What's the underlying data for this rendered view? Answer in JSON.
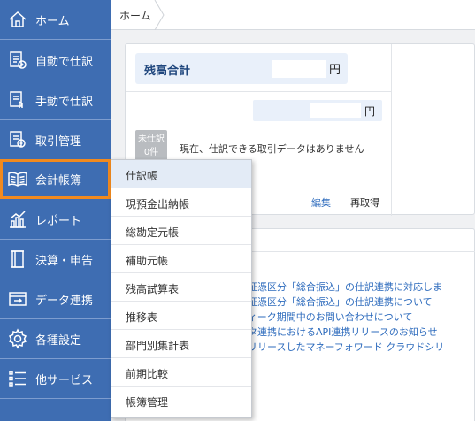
{
  "sidebar": {
    "items": [
      {
        "label": "ホーム",
        "icon": "home-icon"
      },
      {
        "label": "自動で仕訳",
        "icon": "auto-journal-icon"
      },
      {
        "label": "手動で仕訳",
        "icon": "manual-journal-icon"
      },
      {
        "label": "取引管理",
        "icon": "transaction-icon"
      },
      {
        "label": "会計帳簿",
        "icon": "book-icon"
      },
      {
        "label": "レポート",
        "icon": "chart-icon"
      },
      {
        "label": "決算・申告",
        "icon": "document-icon"
      },
      {
        "label": "データ連携",
        "icon": "sync-icon"
      },
      {
        "label": "各種設定",
        "icon": "gear-icon"
      },
      {
        "label": "他サービス",
        "icon": "list-icon"
      }
    ],
    "active_index": 4,
    "active_color": "#f28a1e",
    "bg_color": "#3e6db2"
  },
  "breadcrumb": {
    "home": "ホーム"
  },
  "summary": {
    "total_label": "残高合計",
    "unit": "円",
    "sub_unit": "円",
    "badge_line1": "未仕訳",
    "badge_line2": "0件",
    "notice": "現在、仕訳できる取引データはありません",
    "edit": "編集",
    "refresh": "再取得"
  },
  "news": [
    "の証憑区分「総合振込」の仕訳連携に対応しま",
    "の証憑区分「総合振込」の仕訳連携について",
    "フィーク期間中のお問い合わせについて",
    "ータ連携におけるAPI連携リリースのお知らせ",
    "にリリースしたマネーフォワード クラウドシリ"
  ],
  "dropdown": {
    "items": [
      "仕訳帳",
      "現預金出納帳",
      "総勘定元帳",
      "補助元帳",
      "残高試算表",
      "推移表",
      "部門別集計表",
      "前期比較",
      "帳簿管理"
    ],
    "hover_index": 0
  }
}
